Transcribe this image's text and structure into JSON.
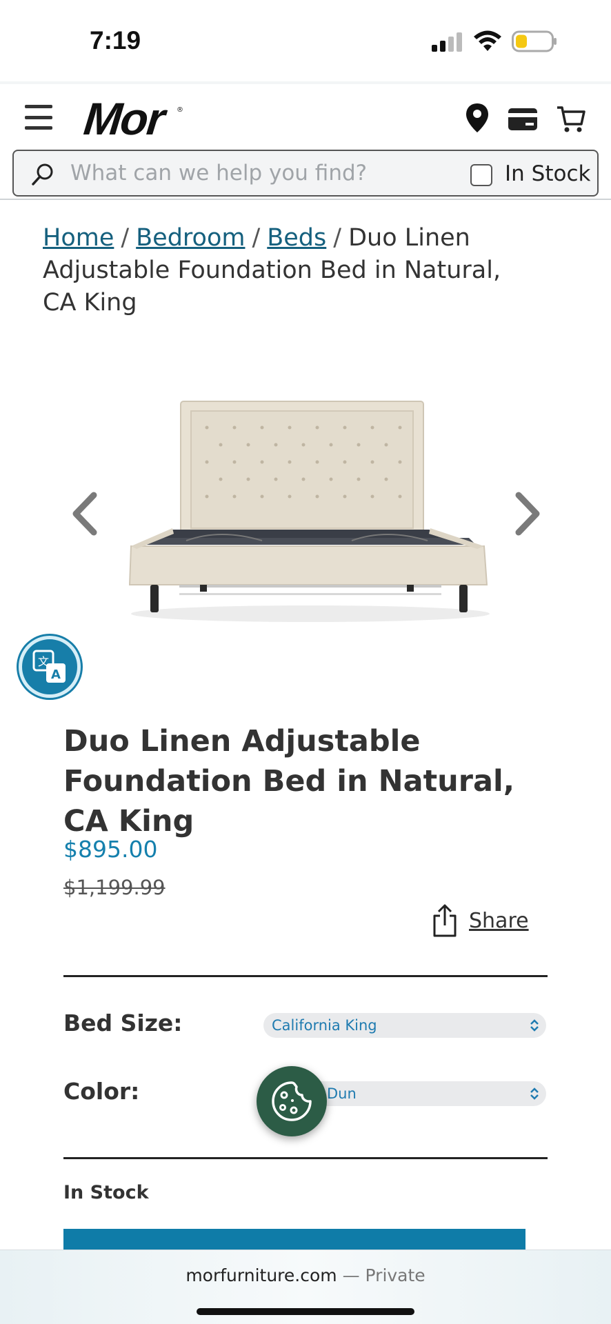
{
  "status_bar": {
    "time": "7:19"
  },
  "header": {
    "logo": "Mor",
    "search_placeholder": "What can we help you find?",
    "in_stock_label": "In Stock"
  },
  "breadcrumb": {
    "home": "Home",
    "bedroom": "Bedroom",
    "beds": "Beds",
    "current": "Duo Linen Adjustable Foundation Bed in Natural, CA King",
    "separator": "/"
  },
  "product": {
    "title": "Duo Linen Adjustable Foundation Bed in Natural, CA King",
    "price": "$895.00",
    "original_price": "$1,199.99",
    "share_label": "Share"
  },
  "options": {
    "bed_size_label": "Bed Size:",
    "bed_size_value": "California King",
    "color_label": "Color:",
    "color_value": "Dun"
  },
  "stock_status": "In Stock",
  "browser": {
    "url": "morfurniture.com",
    "mode": "— Private"
  },
  "colors": {
    "accent": "#1580ad",
    "link": "#15607e",
    "cookie_button": "#2c5c46",
    "cart_button": "#0f7ca8"
  }
}
